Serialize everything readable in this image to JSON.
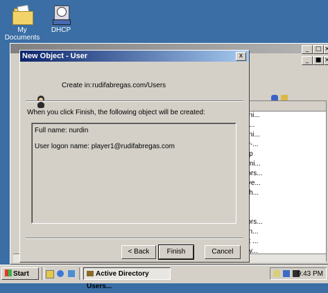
{
  "desktop": {
    "icons": [
      {
        "label": "My Documents",
        "icon": "my-documents-icon"
      },
      {
        "label": "DHCP",
        "icon": "dhcp-icon"
      }
    ]
  },
  "background_window": {
    "list_items": [
      "mini...",
      "an...",
      "mini...",
      "ew-...",
      "oup",
      "ermi...",
      "ators...",
      "erve...",
      "n th...",
      "",
      "",
      "ators...",
      "can...",
      "est ...",
      "ony..."
    ]
  },
  "dialog": {
    "title": "New Object - User",
    "close_label": "x",
    "create_in_label": "Create in:",
    "create_in_path": "rudifabregas.com/Users",
    "info_text": "When you click Finish, the following object will be created:",
    "summary_lines": [
      "Full name: nurdin",
      "User logon name: player1@rudifabregas.com"
    ],
    "buttons": {
      "back": "< Back",
      "finish": "Finish",
      "cancel": "Cancel"
    }
  },
  "taskbar": {
    "start_label": "Start",
    "task_label": "Active Directory Users...",
    "clock": "9:43 PM"
  },
  "colors": {
    "desktop": "#3a6ea5",
    "title_active_start": "#0a246a",
    "title_active_end": "#a6caf0",
    "face": "#d4d0c8"
  }
}
